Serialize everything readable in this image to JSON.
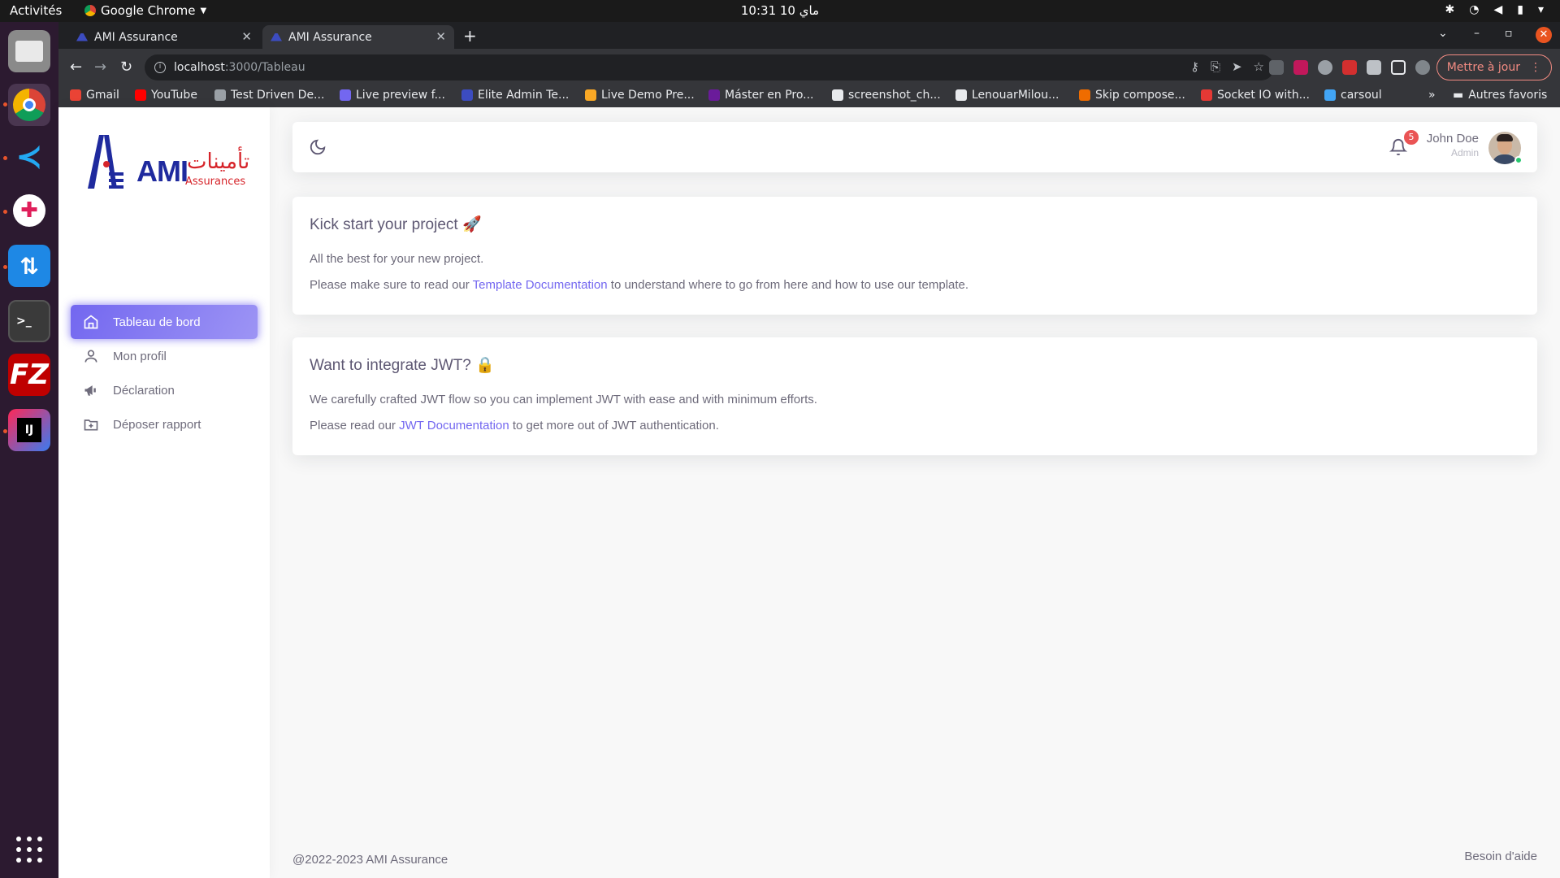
{
  "system": {
    "activities": "Activités",
    "app_name": "Google Chrome",
    "clock": "10:31  10 ماي"
  },
  "browser": {
    "tabs": [
      {
        "title": "AMI Assurance"
      },
      {
        "title": "AMI Assurance"
      }
    ],
    "url_host": "localhost",
    "url_path": ":3000/Tableau",
    "update_button": "Mettre à jour",
    "bookmarks": [
      {
        "label": "Gmail",
        "color": "#ea4335"
      },
      {
        "label": "YouTube",
        "color": "#ff0000"
      },
      {
        "label": "Test Driven De...",
        "color": "#9aa0a6"
      },
      {
        "label": "Live preview f...",
        "color": "#7367f0"
      },
      {
        "label": "Elite Admin Te...",
        "color": "#3c4cc0"
      },
      {
        "label": "Live Demo Pre...",
        "color": "#f9a825"
      },
      {
        "label": "Máster en Pro...",
        "color": "#6a1b9a"
      },
      {
        "label": "screenshot_ch...",
        "color": "#e8eaed"
      },
      {
        "label": "LenouarMilou...",
        "color": "#e8eaed"
      },
      {
        "label": "Skip compose...",
        "color": "#ef6c00"
      },
      {
        "label": "Socket IO with...",
        "color": "#e53935"
      },
      {
        "label": "carsoul",
        "color": "#42a5f5"
      }
    ],
    "bookmarks_more": "»",
    "other_bookmarks": "Autres favoris"
  },
  "sidebar": {
    "logo_text": "AMI",
    "logo_sub": "Assurances",
    "logo_arabic": "تأمينات",
    "items": [
      {
        "label": "Tableau de bord",
        "icon": "home-icon"
      },
      {
        "label": "Mon profil",
        "icon": "user-icon"
      },
      {
        "label": "Déclaration",
        "icon": "megaphone-icon"
      },
      {
        "label": "Déposer rapport",
        "icon": "folder-plus-icon"
      }
    ]
  },
  "navbar": {
    "notifications_count": "5",
    "user_name": "John Doe",
    "user_role": "Admin"
  },
  "cards": [
    {
      "title": "Kick start your project 🚀",
      "line1": "All the best for your new project.",
      "line2_pre": "Please make sure to read our ",
      "line2_link": "Template Documentation",
      "line2_post": " to understand where to go from here and how to use our template."
    },
    {
      "title": "Want to integrate JWT? 🔒",
      "line1": "We carefully crafted JWT flow so you can implement JWT with ease and with minimum efforts.",
      "line2_pre": "Please read our ",
      "line2_link": "JWT Documentation",
      "line2_post": " to get more out of JWT authentication."
    }
  ],
  "footer": {
    "copyright": "@2022-2023 AMI Assurance",
    "help": "Besoin d'aide"
  },
  "colors": {
    "accent": "#7367f0",
    "danger": "#ea5455",
    "success": "#28c76f"
  }
}
